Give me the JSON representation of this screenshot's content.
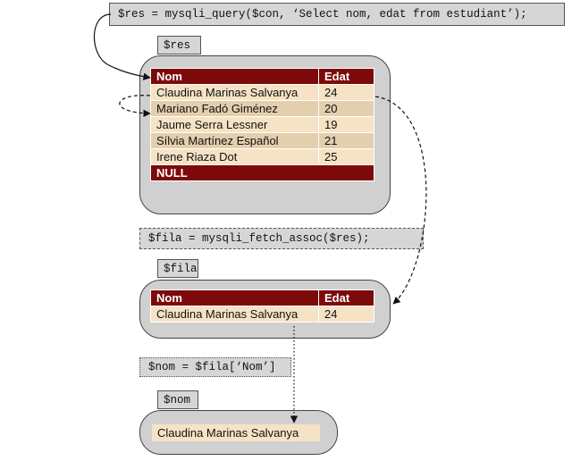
{
  "code": {
    "query": "$res = mysqli_query($con, ‘Select nom, edat from estudiant’);",
    "fetch": "$fila = mysqli_fetch_assoc($res);",
    "access": "$nom = $fila[‘Nom’]"
  },
  "vars": {
    "res": "$res",
    "fila": "$fila",
    "nom": "$nom"
  },
  "res_table": {
    "headers": [
      "Nom",
      "Edat"
    ],
    "rows": [
      {
        "nom": "Claudina Marinas Salvanya",
        "edat": "24"
      },
      {
        "nom": "Mariano Fadó Giménez",
        "edat": "20"
      },
      {
        "nom": "Jaume Serra Lessner",
        "edat": "19"
      },
      {
        "nom": "Sílvia Martínez Español",
        "edat": "21"
      },
      {
        "nom": "Irene Riaza Dot",
        "edat": "25"
      }
    ],
    "null_label": "NULL"
  },
  "fila_table": {
    "headers": [
      "Nom",
      "Edat"
    ],
    "row": {
      "nom": "Claudina Marinas Salvanya",
      "edat": "24"
    }
  },
  "nom_value": "Claudina Marinas Salvanya",
  "colors": {
    "header": "#7d0a0a",
    "row_light": "#f6e3c5",
    "row_dark": "#e3cfae",
    "container": "#d0d0d0"
  }
}
